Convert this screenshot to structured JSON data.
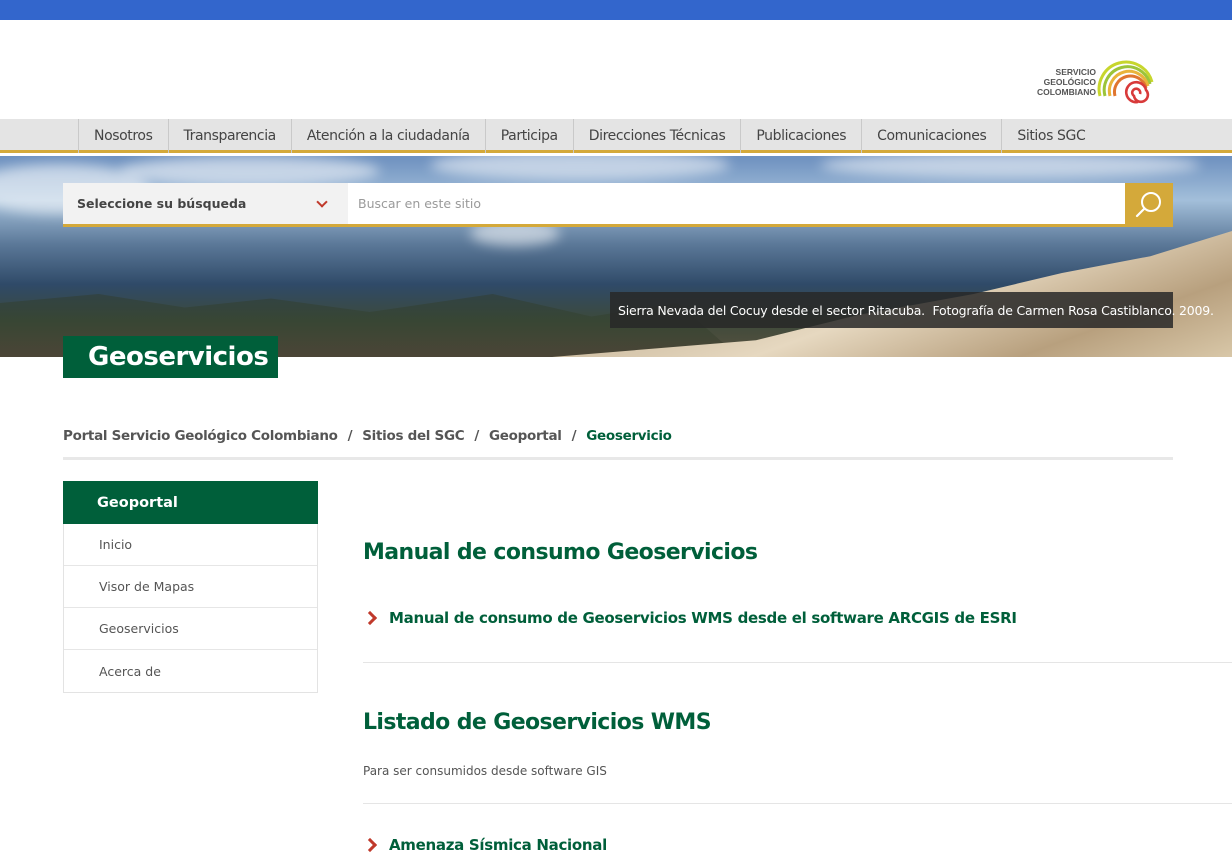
{
  "logo": {
    "line1": "SERVICIO",
    "line2": "GEOLÓGICO",
    "line3": "COLOMBIANO"
  },
  "nav": {
    "items": [
      "Nosotros",
      "Transparencia",
      "Atención a la ciudadanía",
      "Participa",
      "Direcciones Técnicas",
      "Publicaciones",
      "Comunicaciones",
      "Sitios SGC"
    ]
  },
  "search": {
    "select_label": "Seleccione su búsqueda",
    "placeholder": "Buscar en este sitio"
  },
  "hero": {
    "caption": "Sierra Nevada del Cocuy desde el sector Ritacuba.  Fotografía de Carmen Rosa Castiblanco. 2009."
  },
  "page_title": "Geoservicios",
  "breadcrumb": {
    "items": [
      "Portal Servicio Geológico Colombiano",
      "Sitios del SGC",
      "Geoportal",
      "Geoservicio"
    ],
    "separator": "/"
  },
  "sidebar": {
    "title": "Geoportal",
    "items": [
      "Inicio",
      "Visor de Mapas",
      "Geoservicios",
      "Acerca de"
    ]
  },
  "main": {
    "section1_title": "Manual de consumo Geoservicios",
    "section1_link": "Manual de consumo de Geoservicios WMS desde el software ARCGIS de ESRI",
    "section2_title": "Listado de Geoservicios WMS",
    "section2_desc": "Para ser consumidos desde software GIS",
    "section2_link": "Amenaza Sísmica Nacional"
  },
  "colors": {
    "topbar": "#3366cc",
    "brand_green": "#005f3a",
    "accent_gold": "#d4a93a",
    "arrow_red": "#c0392b"
  }
}
